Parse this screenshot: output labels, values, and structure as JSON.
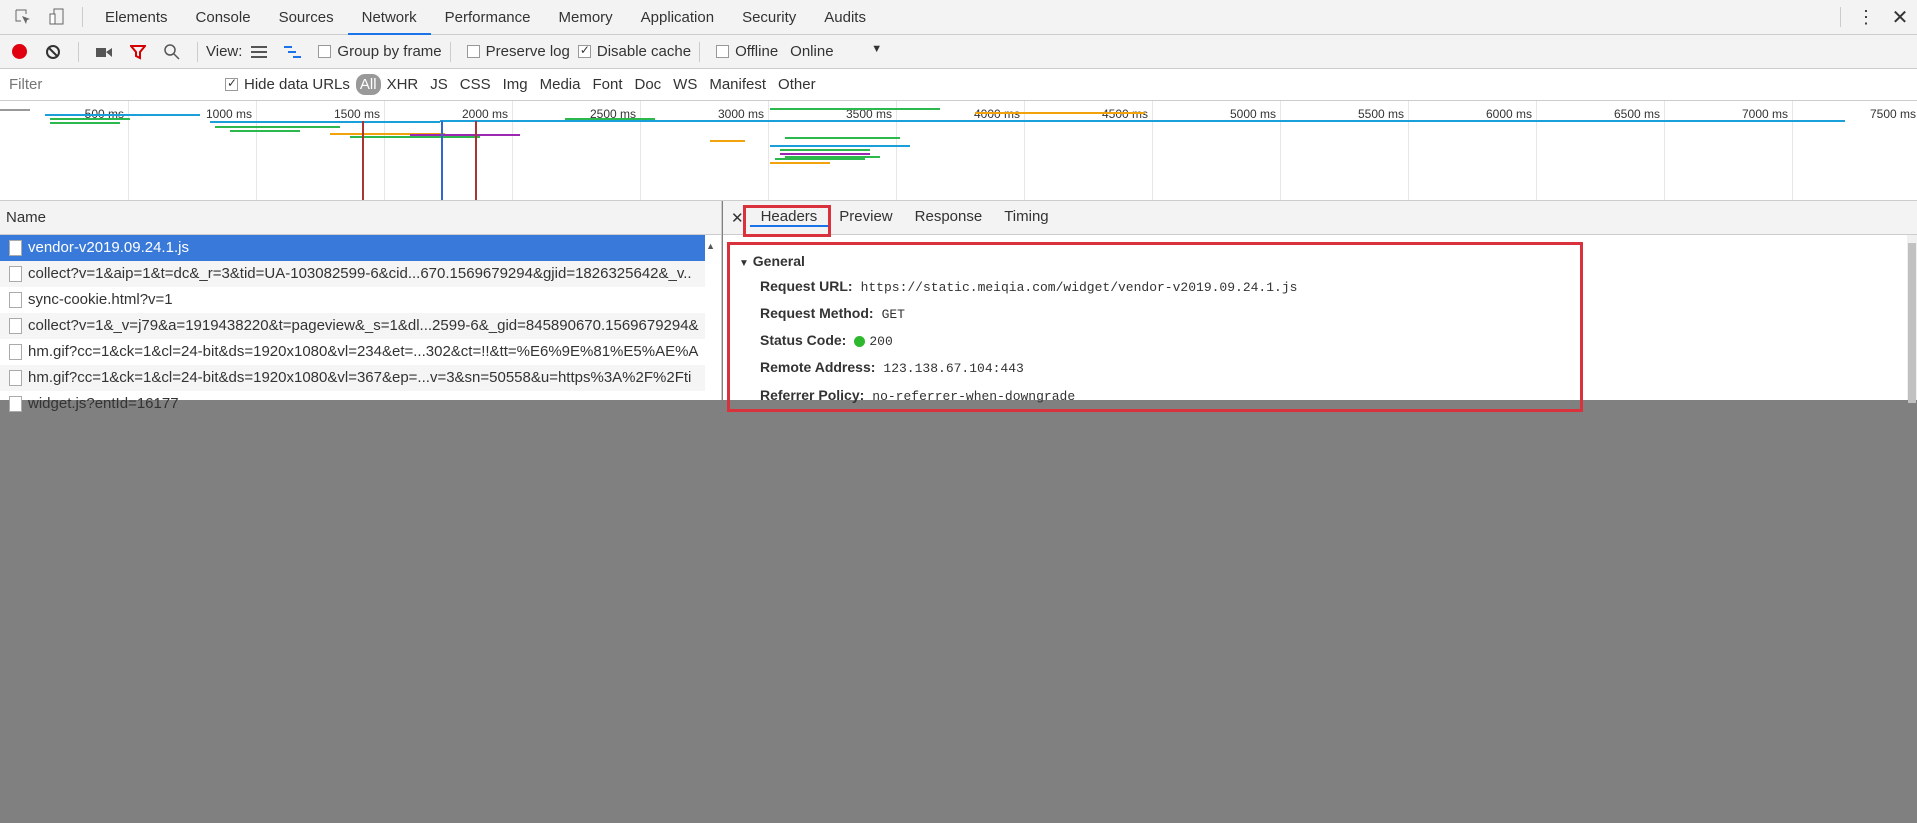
{
  "tabs": [
    "Elements",
    "Console",
    "Sources",
    "Network",
    "Performance",
    "Memory",
    "Application",
    "Security",
    "Audits"
  ],
  "active_tab": "Network",
  "toolbar": {
    "view_label": "View:",
    "group_by_frame": "Group by frame",
    "preserve_log": "Preserve log",
    "disable_cache": "Disable cache",
    "offline": "Offline",
    "throttle": "Online",
    "disable_cache_checked": true,
    "group_by_frame_checked": false,
    "preserve_log_checked": false,
    "offline_checked": false
  },
  "filterbar": {
    "placeholder": "Filter",
    "hide_data_urls": "Hide data URLs",
    "hide_data_urls_checked": true,
    "types": [
      "All",
      "XHR",
      "JS",
      "CSS",
      "Img",
      "Media",
      "Font",
      "Doc",
      "WS",
      "Manifest",
      "Other"
    ]
  },
  "overview": {
    "ticks": [
      "500 ms",
      "1000 ms",
      "1500 ms",
      "2000 ms",
      "2500 ms",
      "3000 ms",
      "3500 ms",
      "4000 ms",
      "4500 ms",
      "5000 ms",
      "5500 ms",
      "6000 ms",
      "6500 ms",
      "7000 ms",
      "7500 ms"
    ]
  },
  "list": {
    "header": "Name",
    "rows": [
      "vendor-v2019.09.24.1.js",
      "collect?v=1&aip=1&t=dc&_r=3&tid=UA-103082599-6&cid...670.1569679294&gjid=1826325642&_v..",
      "sync-cookie.html?v=1",
      "collect?v=1&_v=j79&a=1919438220&t=pageview&_s=1&dl...2599-6&_gid=845890670.1569679294&",
      "hm.gif?cc=1&ck=1&cl=24-bit&ds=1920x1080&vl=234&et=...302&ct=!!&tt=%E6%9E%81%E5%AE%A",
      "hm.gif?cc=1&ck=1&cl=24-bit&ds=1920x1080&vl=367&ep=...v=3&sn=50558&u=https%3A%2F%2Fti",
      "widget.js?entId=16177"
    ]
  },
  "detail": {
    "tabs": [
      "Headers",
      "Preview",
      "Response",
      "Timing"
    ],
    "active": "Headers",
    "section": "General",
    "request_url_label": "Request URL:",
    "request_url": "https://static.meiqia.com/widget/vendor-v2019.09.24.1.js",
    "method_label": "Request Method:",
    "method": "GET",
    "status_label": "Status Code:",
    "status": "200",
    "status_color": "#2eb82e",
    "remote_label": "Remote Address:",
    "remote": "123.138.67.104:443",
    "referrer_label": "Referrer Policy:",
    "referrer": "no-referrer-when-downgrade"
  },
  "colors": {
    "highlight": "#d9323c",
    "selected_row": "#3879d9"
  }
}
